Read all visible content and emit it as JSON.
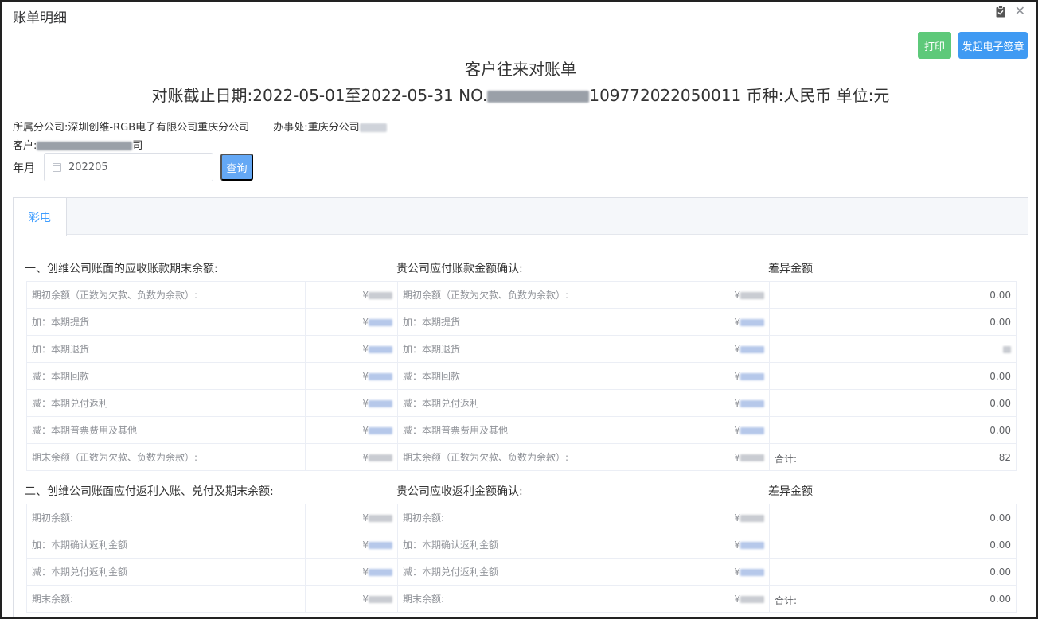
{
  "modal": {
    "title": "账单明细"
  },
  "buttons": {
    "print": "打印",
    "sign": "发起电子签章",
    "query": "查询"
  },
  "doc": {
    "title": "客户往来对账单",
    "sub_prefix": "对账截止日期:2022-05-01至2022-05-31 NO.",
    "sub_code_tail": "109772022050011",
    "sub_suffix": " 币种:人民币 单位:元"
  },
  "info": {
    "company_label": "所属分公司:",
    "company": "深圳创维-RGB电子有限公司重庆分公司",
    "office_label": "办事处:",
    "office": "重庆分公司",
    "customer_label": "客户:",
    "customer_tail": "司"
  },
  "filter": {
    "label": "年月",
    "value": "202205"
  },
  "tabs": [
    {
      "label": "彩电"
    }
  ],
  "section1": {
    "left_title": "一、创维公司账面的应收账款期末余额:",
    "mid_title": "贵公司应付账款金额确认:",
    "right_title": "差异金额",
    "rows": [
      {
        "left_label": "期初余额（正数为欠款、负数为余款）:",
        "mid_label": "期初余额（正数为欠款、负数为余款）:",
        "diff_label": "",
        "diff": "0.00"
      },
      {
        "left_label": "加：本期提货",
        "mid_label": "加：本期提货",
        "diff_label": "",
        "diff": "0.00"
      },
      {
        "left_label": "加：本期退货",
        "mid_label": "加：本期退货",
        "diff_label": "",
        "diff": ""
      },
      {
        "left_label": "减：本期回款",
        "mid_label": "减：本期回款",
        "diff_label": "",
        "diff": "0.00"
      },
      {
        "left_label": "减：本期兑付返利",
        "mid_label": "减：本期兑付返利",
        "diff_label": "",
        "diff": "0.00"
      },
      {
        "left_label": "减：本期普票费用及其他",
        "mid_label": "减：本期普票费用及其他",
        "diff_label": "",
        "diff": "0.00"
      },
      {
        "left_label": "期末余额（正数为欠款、负数为余款）:",
        "mid_label": "期末余额（正数为欠款、负数为余款）:",
        "diff_label": "合计:",
        "diff": "82"
      }
    ]
  },
  "section2": {
    "left_title": "二、创维公司账面应付返利入账、兑付及期末余额:",
    "mid_title": "贵公司应收返利金额确认:",
    "right_title": "差异金额",
    "rows": [
      {
        "left_label": "期初余额:",
        "mid_label": "期初余额:",
        "diff_label": "",
        "diff": "0.00"
      },
      {
        "left_label": "加：本期确认返利金额",
        "mid_label": "加：本期确认返利金额",
        "diff_label": "",
        "diff": "0.00"
      },
      {
        "left_label": "减：本期兑付返利金额",
        "mid_label": "减：本期兑付返利金额",
        "diff_label": "",
        "diff": "0.00"
      },
      {
        "left_label": "期末余额:",
        "mid_label": "期末余额:",
        "diff_label": "合计:",
        "diff": "0.00"
      }
    ]
  },
  "currency_symbol": "¥",
  "colors": {
    "print": "#5ec97a",
    "sign": "#3f9af3",
    "query": "#64a8f5",
    "tab_active": "#409eff"
  }
}
